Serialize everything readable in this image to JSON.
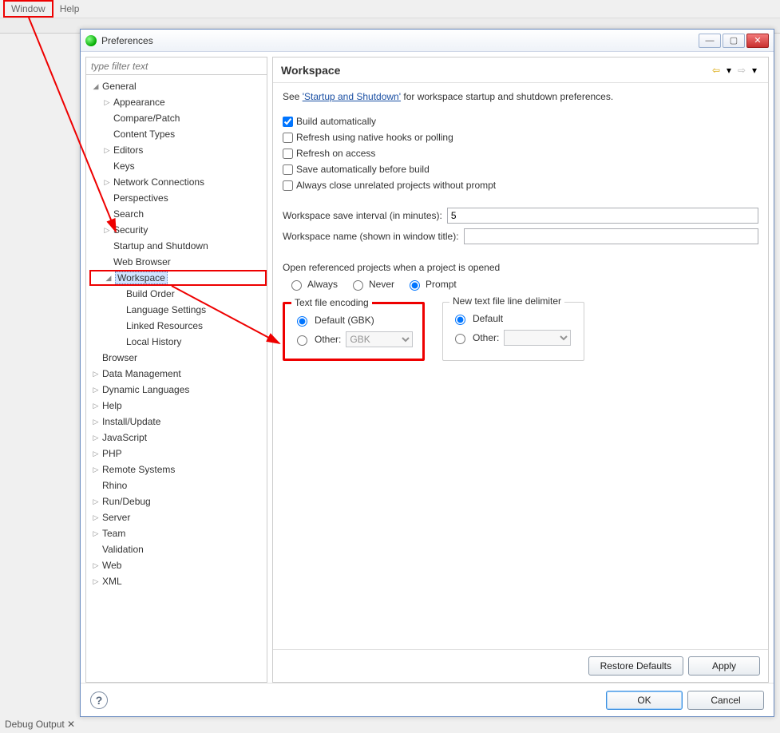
{
  "menubar": {
    "window": "Window",
    "help": "Help"
  },
  "bottom_tab": "Debug Output",
  "dialog": {
    "title": "Preferences",
    "filter_placeholder": "type filter text",
    "tree": {
      "general": "General",
      "appearance": "Appearance",
      "compare_patch": "Compare/Patch",
      "content_types": "Content Types",
      "editors": "Editors",
      "keys": "Keys",
      "network": "Network Connections",
      "perspectives": "Perspectives",
      "search": "Search",
      "security": "Security",
      "startup": "Startup and Shutdown",
      "web_browser": "Web Browser",
      "workspace": "Workspace",
      "build_order": "Build Order",
      "lang_settings": "Language Settings",
      "linked_res": "Linked Resources",
      "local_hist": "Local History",
      "browser": "Browser",
      "data_mgmt": "Data Management",
      "dyn_lang": "Dynamic Languages",
      "help": "Help",
      "install": "Install/Update",
      "javascript": "JavaScript",
      "php": "PHP",
      "remote": "Remote Systems",
      "rhino": "Rhino",
      "rundebug": "Run/Debug",
      "server": "Server",
      "team": "Team",
      "validation": "Validation",
      "web": "Web",
      "xml": "XML"
    },
    "page": {
      "heading": "Workspace",
      "intro_pre": "See ",
      "intro_link": "'Startup and Shutdown'",
      "intro_post": " for workspace startup and shutdown preferences.",
      "chk_build": "Build automatically",
      "chk_refresh_native": "Refresh using native hooks or polling",
      "chk_refresh_access": "Refresh on access",
      "chk_save_before": "Save automatically before build",
      "chk_close_unrelated": "Always close unrelated projects without prompt",
      "lbl_interval": "Workspace save interval (in minutes):",
      "val_interval": "5",
      "lbl_wsname": "Workspace name (shown in window title):",
      "val_wsname": "",
      "lbl_openref": "Open referenced projects when a project is opened",
      "r_always": "Always",
      "r_never": "Never",
      "r_prompt": "Prompt",
      "grp_enc": {
        "legend": "Text file encoding",
        "default": "Default (GBK)",
        "other": "Other:",
        "other_val": "GBK"
      },
      "grp_delim": {
        "legend": "New text file line delimiter",
        "default": "Default",
        "other": "Other:",
        "other_val": ""
      },
      "btn_restore": "Restore Defaults",
      "btn_apply": "Apply"
    },
    "footer": {
      "ok": "OK",
      "cancel": "Cancel"
    }
  }
}
